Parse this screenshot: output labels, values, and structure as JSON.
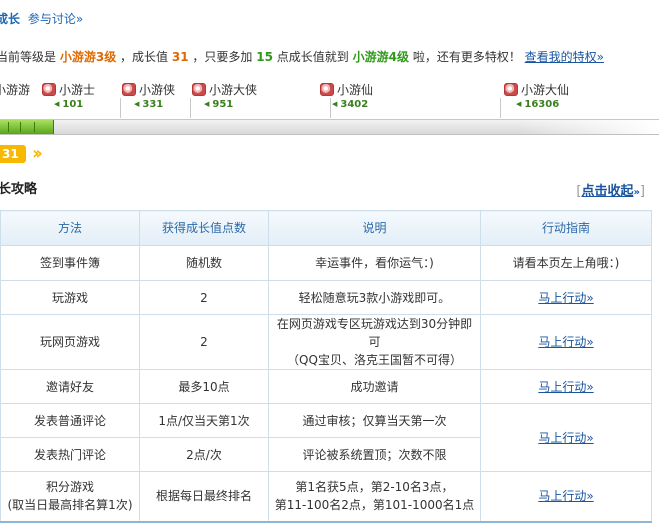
{
  "top": {
    "title": "成长",
    "discuss": "参与讨论»"
  },
  "status": {
    "p1": "当前等级是",
    "level": "小游游3级",
    "p2": "，成长值",
    "value": "31",
    "p3": "，只要多加",
    "needed": "15",
    "p4": "点成长值就到",
    "next_level": "小游游4级",
    "p5": "啦，还有更多特权！",
    "link": "查看我的特权»"
  },
  "levels": [
    {
      "name": "小游游",
      "points": ""
    },
    {
      "name": "小游士",
      "points": "101"
    },
    {
      "name": "小游侠",
      "points": "331"
    },
    {
      "name": "小游大侠",
      "points": "951"
    },
    {
      "name": "小游仙",
      "points": "3402"
    },
    {
      "name": "小游大仙",
      "points": "16306"
    }
  ],
  "progress": {
    "current": "31",
    "fill_fraction": 0.08
  },
  "section": {
    "title": "长攻略",
    "open": "[",
    "collapse": "点击收起",
    "close": "]"
  },
  "table": {
    "headers": [
      "方法",
      "获得成长值点数",
      "说明",
      "行动指南"
    ],
    "rows": [
      {
        "method": "签到事件簿",
        "points": "随机数",
        "desc1": "幸运事件，看你运气：)",
        "desc2": "",
        "action": "请看本页左上角哦：)"
      },
      {
        "method": "玩游戏",
        "points": "2",
        "desc1": "轻松随意玩3款小游戏即可。",
        "desc2": "",
        "action": "马上行动»"
      },
      {
        "method": "玩网页游戏",
        "points": "2",
        "desc1": "在网页游戏专区玩游戏达到30分钟即可",
        "desc2": "（QQ宝贝、洛克王国暂不可得）",
        "action": "马上行动»"
      },
      {
        "method": "邀请好友",
        "points": "最多10点",
        "desc1": "成功邀请",
        "desc2": "",
        "action": "马上行动»"
      },
      {
        "method": "发表普通评论",
        "points": "1点/仅当天第1次",
        "desc1": "通过审核；仅算当天第一次",
        "desc2": "",
        "action": "马上行动»"
      },
      {
        "method": "发表热门评论",
        "points": "2点/次",
        "desc1": "评论被系统置顶；次数不限",
        "desc2": "",
        "action": ""
      },
      {
        "method": "积分游戏",
        "method2": "(取当日最高排名算1次)",
        "points": "根据每日最终排名",
        "desc1": "第1名获5点，第2-10名3点，",
        "desc2": "第11-100名2点，第101-1000名1点",
        "action": "马上行动»"
      }
    ]
  },
  "colors": {
    "orange": "#e06a00",
    "green": "#2f9a1a",
    "link": "#1a55a0",
    "bar_fill": "#5aa617",
    "badge": "#f6b800"
  }
}
